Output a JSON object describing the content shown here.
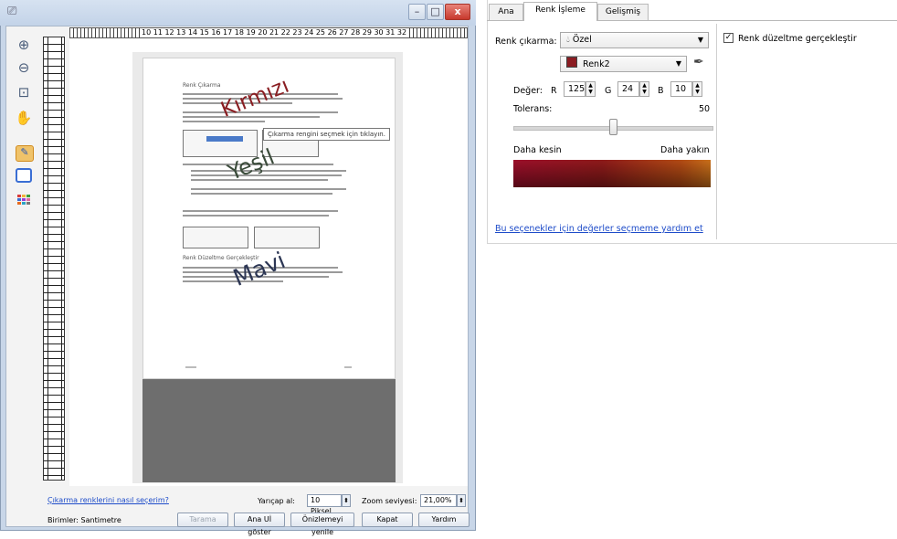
{
  "window": {
    "app_icon": "scanner-icon",
    "minimize": "–",
    "maximize": "□",
    "close": "x"
  },
  "toolbar": {
    "zoom_in": "zoom-in-icon",
    "zoom_out": "zoom-out-icon",
    "zoom_fit": "zoom-fit-icon",
    "pan": "hand-icon",
    "color_picker": "eyedropper-icon",
    "color_frame": "color-frame-icon",
    "palette": "palette-icon"
  },
  "ruler": {
    "horizontal_labels": "10 11 12 13 14 15 16 17 18 19 20 21 22 23 24 25 26 27 28 29 30 31 32"
  },
  "preview": {
    "doc_heading1": "Renk Çıkarma",
    "doc_heading2": "Renk Düzeltme Gerçekleştir",
    "watermark_red": "Kırmızı",
    "watermark_green": "Yeşil",
    "watermark_blue": "Mavi",
    "tooltip": "Çıkarma rengini seçmek için tıklayın."
  },
  "bottom": {
    "help_link": "Çıkarma renklerini nasıl seçerim?",
    "tolerance_label": "Yarıçap al:",
    "tolerance_value": "10 Piksel",
    "zoom_label": "Zoom seviyesi:",
    "zoom_value": "21,00%",
    "units": "Birimler: Santimetre",
    "btn_scan": "Tarama",
    "btn_show_main": "Ana Uİ göster",
    "btn_refresh": "Önizlemeyi yenile",
    "btn_close": "Kapat",
    "btn_help": "Yardım"
  },
  "panel": {
    "tabs": [
      {
        "label": "Ana",
        "active": false
      },
      {
        "label": "Renk İşleme",
        "active": true
      },
      {
        "label": "Gelişmiş",
        "active": false
      }
    ],
    "color_drop_label": "Renk çıkarma:",
    "color_drop_value": "Özel",
    "color_drop_icon": "droplet-icon",
    "color_name_value": "Renk2",
    "color_swatch": "#8b1c22",
    "value_label": "Değer:",
    "r_label": "R",
    "r_value": "125",
    "g_label": "G",
    "g_value": "24",
    "b_label": "B",
    "b_value": "10",
    "tolerance_label": "Tolerans:",
    "tolerance_value": "50",
    "tolerance_level": 0.5,
    "stricter_label": "Daha kesin",
    "looser_label": "Daha yakın",
    "gradient_colors": [
      "#9c0f2a",
      "#8e1a1a",
      "#b24a14",
      "#c9701a"
    ],
    "help_link": "Bu seçenekler için değerler seçmeme yardım et",
    "color_correct_label": "Renk düzeltme gerçekleştir",
    "color_correct_checked": true
  }
}
